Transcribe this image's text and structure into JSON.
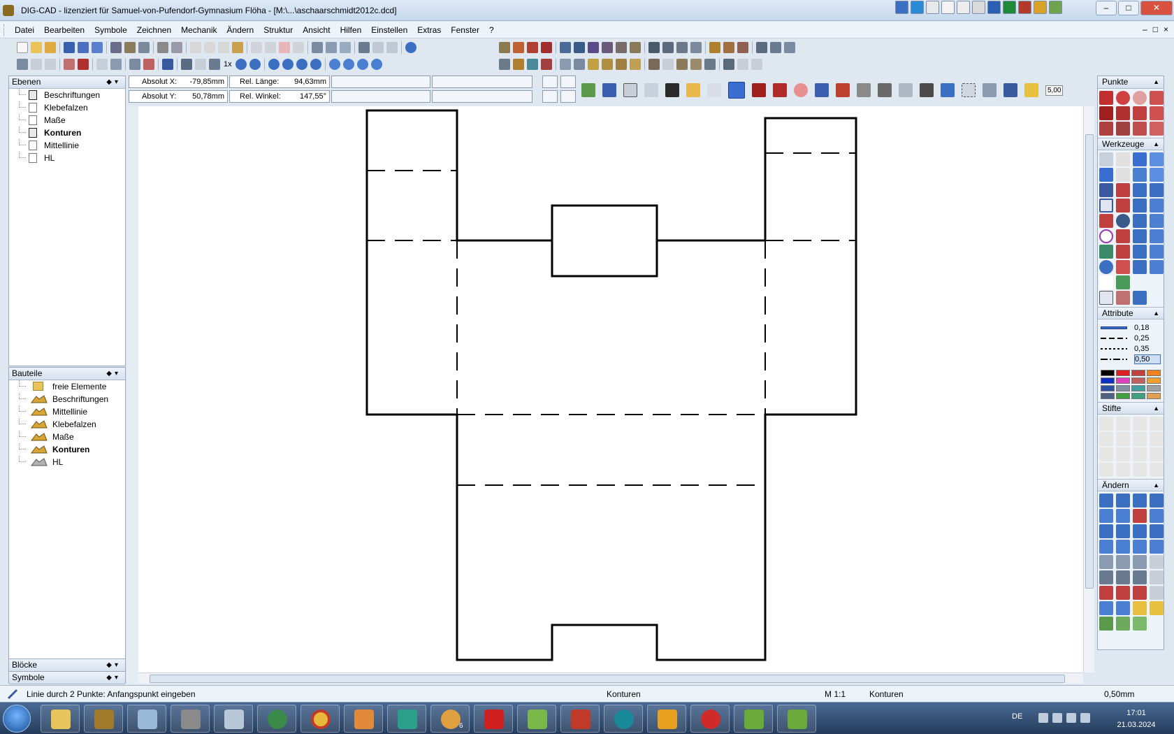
{
  "window": {
    "title": "DIG-CAD - lizenziert für Samuel-von-Pufendorf-Gymnasium Flöha - [M:\\...\\aschaarschmidt2012c.dcd]",
    "minimize": "–",
    "maximize": "□",
    "close": "✕"
  },
  "menu": {
    "items": [
      "Datei",
      "Bearbeiten",
      "Symbole",
      "Zeichnen",
      "Mechanik",
      "Ändern",
      "Struktur",
      "Ansicht",
      "Hilfen",
      "Einstellen",
      "Extras",
      "Fenster",
      "?"
    ],
    "mdi_controls": [
      "–",
      "□",
      "×"
    ]
  },
  "coords": {
    "absolut_x_label": "Absolut X:",
    "absolut_x_value": "-79,85mm",
    "absolut_y_label": "Absolut Y:",
    "absolut_y_value": "50,78mm",
    "rel_laenge_label": "Rel. Länge:",
    "rel_laenge_value": "94,63mm",
    "rel_winkel_label": "Rel. Winkel:",
    "rel_winkel_value": "147,55°"
  },
  "toolbar": {
    "zoom_label": "1x",
    "value_display": "5,00"
  },
  "ebenen": {
    "title": "Ebenen",
    "items": [
      {
        "label": "Beschriftungen",
        "active": false
      },
      {
        "label": "Klebefalzen",
        "active": false
      },
      {
        "label": "Maße",
        "active": false
      },
      {
        "label": "Konturen",
        "active": true
      },
      {
        "label": "Mittellinie",
        "active": false
      },
      {
        "label": "HL",
        "active": false
      }
    ]
  },
  "bauteile": {
    "title": "Bauteile",
    "items": [
      {
        "label": "freie Elemente",
        "bold": false
      },
      {
        "label": "Beschriftungen",
        "bold": false
      },
      {
        "label": "Mittellinie",
        "bold": false
      },
      {
        "label": "Klebefalzen",
        "bold": false
      },
      {
        "label": "Maße",
        "bold": false
      },
      {
        "label": "Konturen",
        "bold": true
      },
      {
        "label": "HL",
        "bold": false
      }
    ]
  },
  "bottom_panels": [
    "Blöcke",
    "Symbole"
  ],
  "palette": {
    "sections": [
      "Punkte",
      "Werkzeuge",
      "Attribute",
      "Stifte",
      "Ändern"
    ],
    "line_widths": [
      "0,18",
      "0,25",
      "0,35",
      "0,50"
    ],
    "selected_width": "0,50",
    "colors": [
      "#000000",
      "#e02020",
      "#c04040",
      "#f08020",
      "#1030c0",
      "#e040c0",
      "#c06060",
      "#f0a030",
      "#3050a0",
      "#8090a0",
      "#40a0a0",
      "#a0a0a0",
      "#506080",
      "#40a040",
      "#40a080",
      "#e0a050"
    ]
  },
  "status": {
    "message": "Linie durch 2 Punkte: Anfangspunkt eingeben",
    "layer": "Konturen",
    "scale": "M 1:1",
    "component": "Konturen",
    "line_width": "0,50mm"
  },
  "taskbar": {
    "language": "DE",
    "time": "17:01",
    "date": "21.03.2024",
    "badge": "6"
  }
}
